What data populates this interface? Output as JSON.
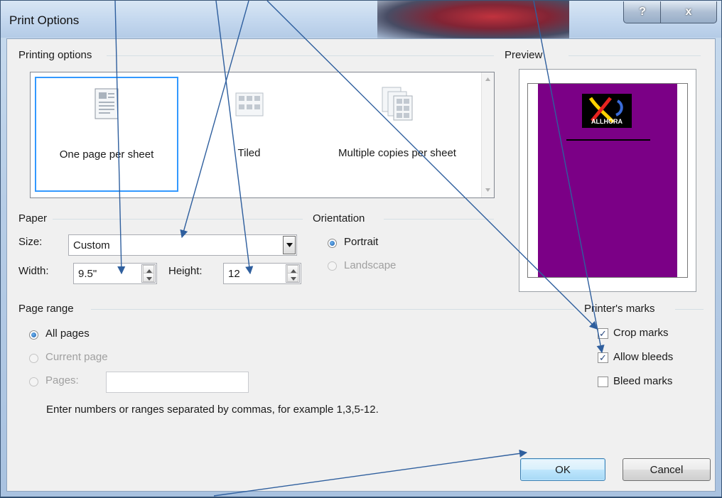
{
  "window": {
    "title": "Print Options",
    "help_label": "?",
    "close_label": "x"
  },
  "printing_options": {
    "label": "Printing options",
    "items": [
      {
        "label": "One page per sheet",
        "selected": true
      },
      {
        "label": "Tiled",
        "selected": false
      },
      {
        "label": "Multiple copies per sheet",
        "selected": false
      }
    ]
  },
  "preview": {
    "label": "Preview",
    "logo_text": "ALLHORA",
    "background_color": "#7b0086"
  },
  "paper": {
    "label": "Paper",
    "size_label": "Size:",
    "size_value": "Custom",
    "width_label": "Width:",
    "width_value": "9.5\"",
    "height_label": "Height:",
    "height_value": "12"
  },
  "orientation": {
    "label": "Orientation",
    "portrait": "Portrait",
    "landscape": "Landscape",
    "selected": "Portrait"
  },
  "page_range": {
    "label": "Page range",
    "all_pages": "All pages",
    "current_page": "Current page",
    "pages": "Pages:",
    "pages_value": "",
    "hint": "Enter numbers or ranges separated by commas, for example 1,3,5-12.",
    "selected": "All pages"
  },
  "printers_marks": {
    "label": "Printer's marks",
    "crop_marks": "Crop marks",
    "crop_checked": true,
    "allow_bleeds": "Allow bleeds",
    "bleeds_checked": true,
    "bleed_marks": "Bleed marks",
    "bleed_marks_checked": false
  },
  "buttons": {
    "ok": "OK",
    "cancel": "Cancel"
  },
  "colors": {
    "accent": "#3399ff",
    "annotation_arrow": "#2f5f9e"
  }
}
